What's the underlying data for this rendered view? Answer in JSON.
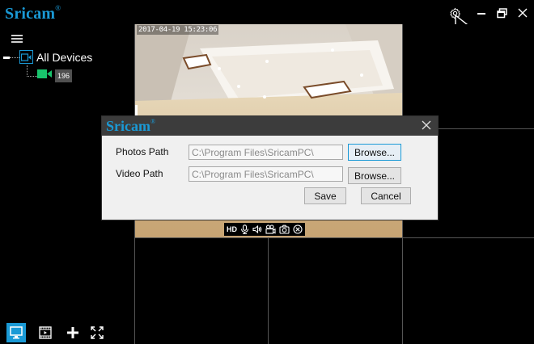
{
  "app": {
    "logo": "Sricam",
    "logo_mark": "®"
  },
  "titlebar": {
    "settings_icon": "gear-icon",
    "minimize_icon": "minimize-icon",
    "restore_icon": "restore-icon",
    "close_icon": "close-icon"
  },
  "sidebar": {
    "tree": {
      "root_label": "All Devices",
      "device_label": "196"
    },
    "bottom_buttons": [
      "monitor-icon",
      "playback-icon",
      "add-icon",
      "fullscreen-icon"
    ]
  },
  "video": {
    "timestamp": "2017-04-19  15:23:06",
    "toolbar": {
      "hd_label": "HD",
      "icons": [
        "microphone-icon",
        "speaker-icon",
        "record-icon",
        "snapshot-icon",
        "close-stream-icon"
      ]
    }
  },
  "dialog": {
    "logo": "Sricam",
    "logo_mark": "®",
    "photos_path_label": "Photos Path",
    "photos_path_value": "C:\\Program Files\\SricamPC\\",
    "video_path_label": "Video Path",
    "video_path_value": "C:\\Program Files\\SricamPC\\",
    "browse_label": "Browse...",
    "save_label": "Save",
    "cancel_label": "Cancel"
  },
  "colors": {
    "accent": "#1a9ad6",
    "background": "#000000",
    "dialog_bg": "#f0f0f0",
    "dialog_header": "#3c3c3c",
    "device_icon": "#19c46d"
  }
}
